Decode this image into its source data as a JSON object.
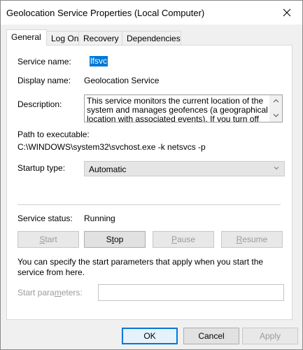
{
  "window": {
    "title": "Geolocation Service Properties (Local Computer)"
  },
  "tabs": [
    {
      "label": "General",
      "active": true
    },
    {
      "label": "Log On",
      "active": false
    },
    {
      "label": "Recovery",
      "active": false
    },
    {
      "label": "Dependencies",
      "active": false
    }
  ],
  "general": {
    "service_name_label": "Service name:",
    "service_name_value": "lfsvc",
    "display_name_label": "Display name:",
    "display_name_value": "Geolocation Service",
    "description_label": "Description:",
    "description_value": "This service monitors the current location of the system and manages geofences (a geographical location with associated events).  If you turn off this",
    "path_label": "Path to executable:",
    "path_value": "C:\\WINDOWS\\system32\\svchost.exe -k netsvcs -p",
    "startup_type_label": "Startup type:",
    "startup_type_value": "Automatic",
    "status_label": "Service status:",
    "status_value": "Running",
    "start_button": {
      "prefix": "",
      "underlined": "S",
      "suffix": "tart"
    },
    "stop_button": {
      "prefix": "S",
      "underlined": "t",
      "suffix": "op"
    },
    "pause_button": {
      "prefix": "",
      "underlined": "P",
      "suffix": "ause"
    },
    "resume_button": {
      "prefix": "",
      "underlined": "R",
      "suffix": "esume"
    },
    "note": "You can specify the start parameters that apply when you start the service from here.",
    "start_params_label": "Start para",
    "start_params_label_underlined": "m",
    "start_params_label_suffix": "eters:",
    "start_params_value": ""
  },
  "footer": {
    "ok": "OK",
    "cancel": "Cancel",
    "apply": "Apply"
  },
  "colors": {
    "selection": "#0078d7",
    "panel_bg": "#ffffff",
    "dialog_bg": "#f0f0f0"
  }
}
